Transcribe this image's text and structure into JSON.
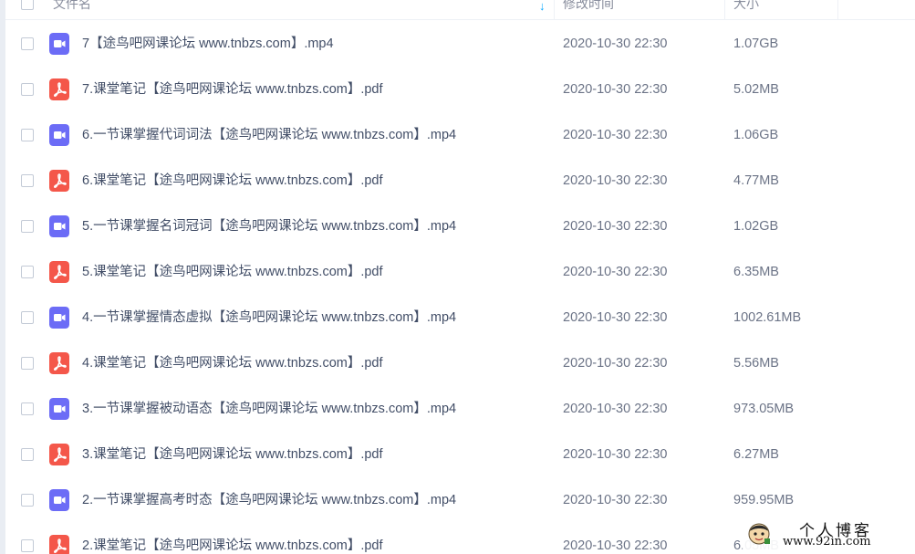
{
  "header": {
    "name_label": "文件名",
    "modified_label": "修改时间",
    "size_label": "大小",
    "sort_icon": "arrow-down-icon"
  },
  "colors": {
    "video_icon": "#6c6cf6",
    "pdf_icon": "#f4574a",
    "accent": "#06a7ff"
  },
  "files": [
    {
      "type": "video",
      "icon": "video-file-icon",
      "name": "7【途鸟吧网课论坛 www.tnbzs.com】.mp4",
      "modified": "2020-10-30 22:30",
      "size": "1.07GB"
    },
    {
      "type": "pdf",
      "icon": "pdf-file-icon",
      "name": "7.课堂笔记【途鸟吧网课论坛 www.tnbzs.com】.pdf",
      "modified": "2020-10-30 22:30",
      "size": "5.02MB"
    },
    {
      "type": "video",
      "icon": "video-file-icon",
      "name": "6.一节课掌握代词词法【途鸟吧网课论坛 www.tnbzs.com】.mp4",
      "modified": "2020-10-30 22:30",
      "size": "1.06GB"
    },
    {
      "type": "pdf",
      "icon": "pdf-file-icon",
      "name": "6.课堂笔记【途鸟吧网课论坛 www.tnbzs.com】.pdf",
      "modified": "2020-10-30 22:30",
      "size": "4.77MB"
    },
    {
      "type": "video",
      "icon": "video-file-icon",
      "name": "5.一节课掌握名词冠词【途鸟吧网课论坛 www.tnbzs.com】.mp4",
      "modified": "2020-10-30 22:30",
      "size": "1.02GB"
    },
    {
      "type": "pdf",
      "icon": "pdf-file-icon",
      "name": "5.课堂笔记【途鸟吧网课论坛 www.tnbzs.com】.pdf",
      "modified": "2020-10-30 22:30",
      "size": "6.35MB"
    },
    {
      "type": "video",
      "icon": "video-file-icon",
      "name": "4.一节课掌握情态虚拟【途鸟吧网课论坛 www.tnbzs.com】.mp4",
      "modified": "2020-10-30 22:30",
      "size": "1002.61MB"
    },
    {
      "type": "pdf",
      "icon": "pdf-file-icon",
      "name": "4.课堂笔记【途鸟吧网课论坛 www.tnbzs.com】.pdf",
      "modified": "2020-10-30 22:30",
      "size": "5.56MB"
    },
    {
      "type": "video",
      "icon": "video-file-icon",
      "name": "3.一节课掌握被动语态【途鸟吧网课论坛 www.tnbzs.com】.mp4",
      "modified": "2020-10-30 22:30",
      "size": "973.05MB"
    },
    {
      "type": "pdf",
      "icon": "pdf-file-icon",
      "name": "3.课堂笔记【途鸟吧网课论坛 www.tnbzs.com】.pdf",
      "modified": "2020-10-30 22:30",
      "size": "6.27MB"
    },
    {
      "type": "video",
      "icon": "video-file-icon",
      "name": "2.一节课掌握高考时态【途鸟吧网课论坛 www.tnbzs.com】.mp4",
      "modified": "2020-10-30 22:30",
      "size": "959.95MB"
    },
    {
      "type": "pdf",
      "icon": "pdf-file-icon",
      "name": "2.课堂笔记【途鸟吧网课论坛 www.tnbzs.com】.pdf",
      "modified": "2020-10-30 22:30",
      "size": "6.05MB"
    }
  ],
  "watermark": {
    "title": "个人博客",
    "url": "www.92in.com",
    "avatar_icon": "cartoon-avatar-icon"
  }
}
